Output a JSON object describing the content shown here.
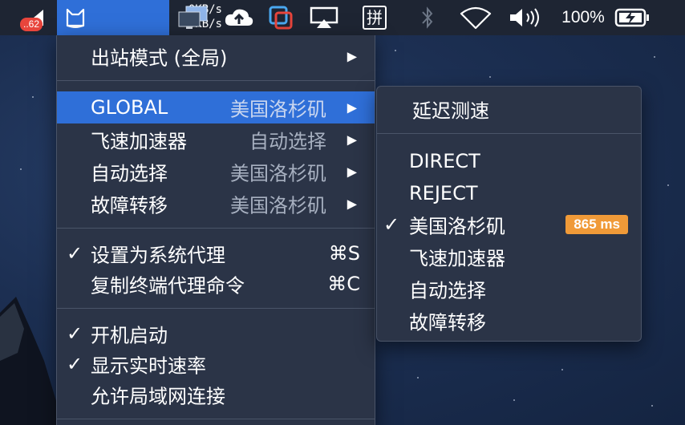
{
  "menubar": {
    "app_badge": "..62",
    "speed_up": "0KB/s",
    "speed_down": "0KB/s",
    "input_method": "拼",
    "battery": "100%"
  },
  "main_menu": {
    "outbound_mode": {
      "label": "出站模式 (全局)"
    },
    "proxy_groups": [
      {
        "label": "GLOBAL",
        "value": "美国洛杉矶",
        "active": true
      },
      {
        "label": "飞速加速器",
        "value": "自动选择"
      },
      {
        "label": "自动选择",
        "value": "美国洛杉矶"
      },
      {
        "label": "故障转移",
        "value": "美国洛杉矶"
      }
    ],
    "system_proxy": {
      "label": "设置为系统代理",
      "shortcut": "⌘S",
      "checked": true
    },
    "copy_terminal": {
      "label": "复制终端代理命令",
      "shortcut": "⌘C"
    },
    "start_at_login": {
      "label": "开机启动",
      "checked": true
    },
    "show_speed": {
      "label": "显示实时速率",
      "checked": true
    },
    "allow_lan": {
      "label": "允许局域网连接"
    }
  },
  "sub_menu": {
    "test_latency": "延迟测速",
    "items": [
      {
        "label": "DIRECT"
      },
      {
        "label": "REJECT"
      },
      {
        "label": "美国洛杉矶",
        "checked": true,
        "latency": "865 ms"
      },
      {
        "label": "飞速加速器"
      },
      {
        "label": "自动选择"
      },
      {
        "label": "故障转移"
      }
    ]
  },
  "colors": {
    "highlight": "#2f6fd8",
    "latency_badge": "#f09a38",
    "menu_bg": "#2b3447"
  }
}
